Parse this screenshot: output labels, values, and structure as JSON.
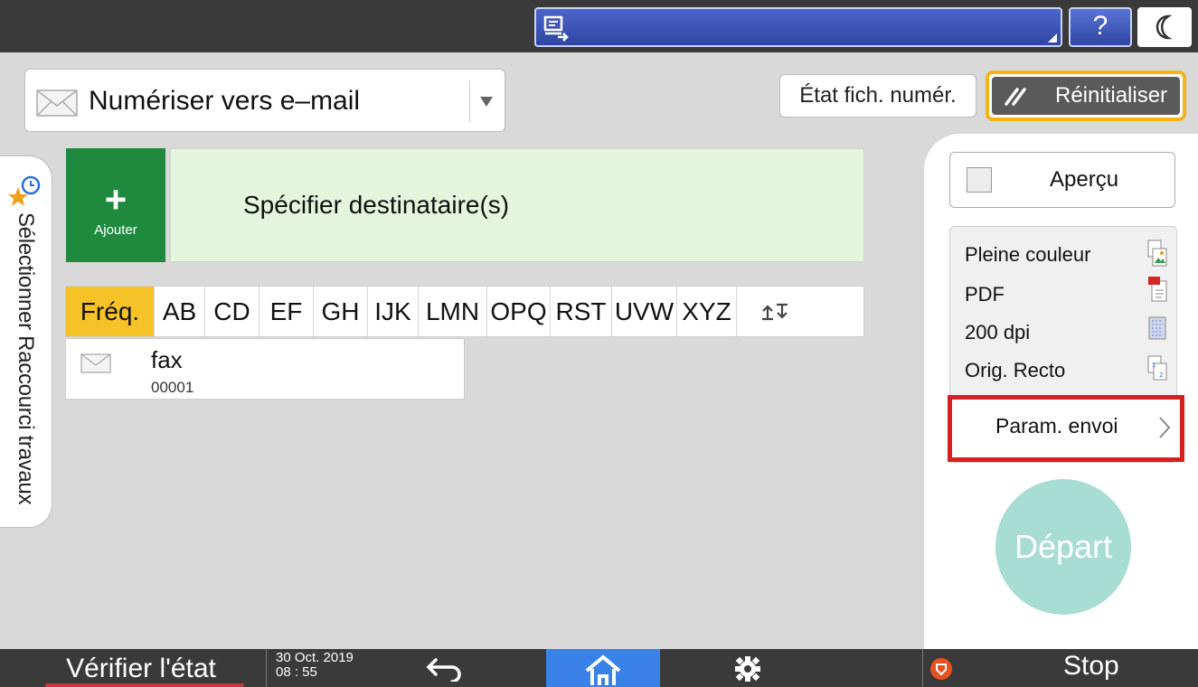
{
  "topbar": {
    "help_label": "?"
  },
  "function_select": {
    "label": "Numériser vers e–mail"
  },
  "actions": {
    "scan_status_label": "État fich. numér.",
    "reset_label": "Réinitialiser"
  },
  "side_tab": {
    "label": "Sélectionner Raccourci travaux"
  },
  "destination": {
    "add_symbol": "+",
    "add_label": "Ajouter",
    "placeholder": "Spécifier destinataire(s)"
  },
  "index_tabs": [
    "Fréq.",
    "AB",
    "CD",
    "EF",
    "GH",
    "IJK",
    "LMN",
    "OPQ",
    "RST",
    "UVW",
    "XYZ"
  ],
  "entries": [
    {
      "name": "fax",
      "number": "00001"
    }
  ],
  "right_panel": {
    "preview_label": "Aperçu",
    "settings": [
      "Pleine couleur",
      "PDF",
      "200 dpi",
      "Orig. Recto"
    ],
    "send_settings_label": "Param. envoi",
    "start_label": "Départ"
  },
  "bottombar": {
    "check_status_label": "Vérifier l'état",
    "date": "30 Oct. 2019",
    "time": "08 : 55",
    "stop_label": "Stop"
  },
  "colors": {
    "accent_green": "#1f8a3e",
    "active_tab": "#f5c227",
    "highlight_red": "#d81f1f",
    "home_blue": "#3b82e8",
    "start_teal": "#a8ddd4"
  }
}
